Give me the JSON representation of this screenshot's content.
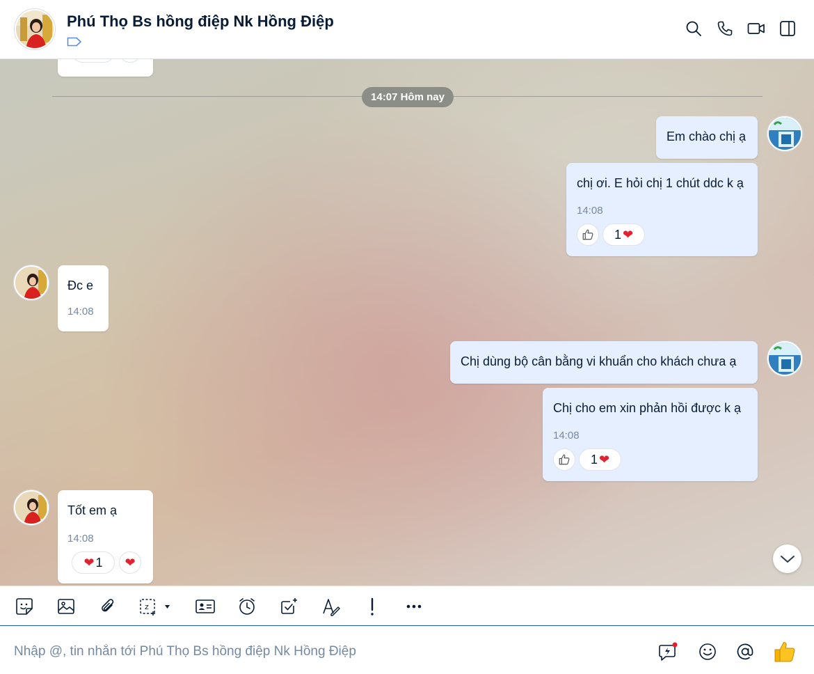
{
  "header": {
    "title": "Phú Thọ Bs hồng điệp Nk Hồng Điệp",
    "icons": [
      "search-icon",
      "phone-icon",
      "video-icon",
      "sidebar-toggle-icon",
      "tag-icon"
    ]
  },
  "chat": {
    "time_divider": "14:07 Hôm nay",
    "messages": [
      {
        "id": "m1",
        "sender": "me",
        "text": "Em chào chị ạ"
      },
      {
        "id": "m2",
        "sender": "me",
        "text": "chị ơi. E hỏi chị 1 chút ddc k ạ",
        "time": "14:08",
        "reaction_count": "1"
      },
      {
        "id": "m3",
        "sender": "contact",
        "text": "Đc e",
        "time": "14:08"
      },
      {
        "id": "m4",
        "sender": "me",
        "text": "Chị dùng bộ cân bằng vi khuẩn cho khách chưa ạ"
      },
      {
        "id": "m5",
        "sender": "me",
        "text": "Chị cho em xin phản hồi được k ạ",
        "time": "14:08",
        "reaction_count": "1"
      },
      {
        "id": "m6",
        "sender": "contact",
        "text": "Tốt em ạ",
        "time": "14:08",
        "reaction_count": "1"
      }
    ],
    "prev_message_reaction_count": "1"
  },
  "toolbar": {
    "icons": [
      "sticker-icon",
      "image-icon",
      "attachment-icon",
      "screenshot-icon",
      "contact-card-icon",
      "reminder-icon",
      "todo-icon",
      "text-format-icon",
      "urgent-icon",
      "more-icon"
    ]
  },
  "composer": {
    "placeholder": "Nhập @, tin nhắn tới Phú Thọ Bs hồng điệp Nk Hồng Điệp",
    "value": ""
  },
  "colors": {
    "outgoing_bubble": "#e5efff",
    "incoming_bubble": "#ffffff",
    "accent": "#0068ff",
    "heart": "#e5202e"
  }
}
